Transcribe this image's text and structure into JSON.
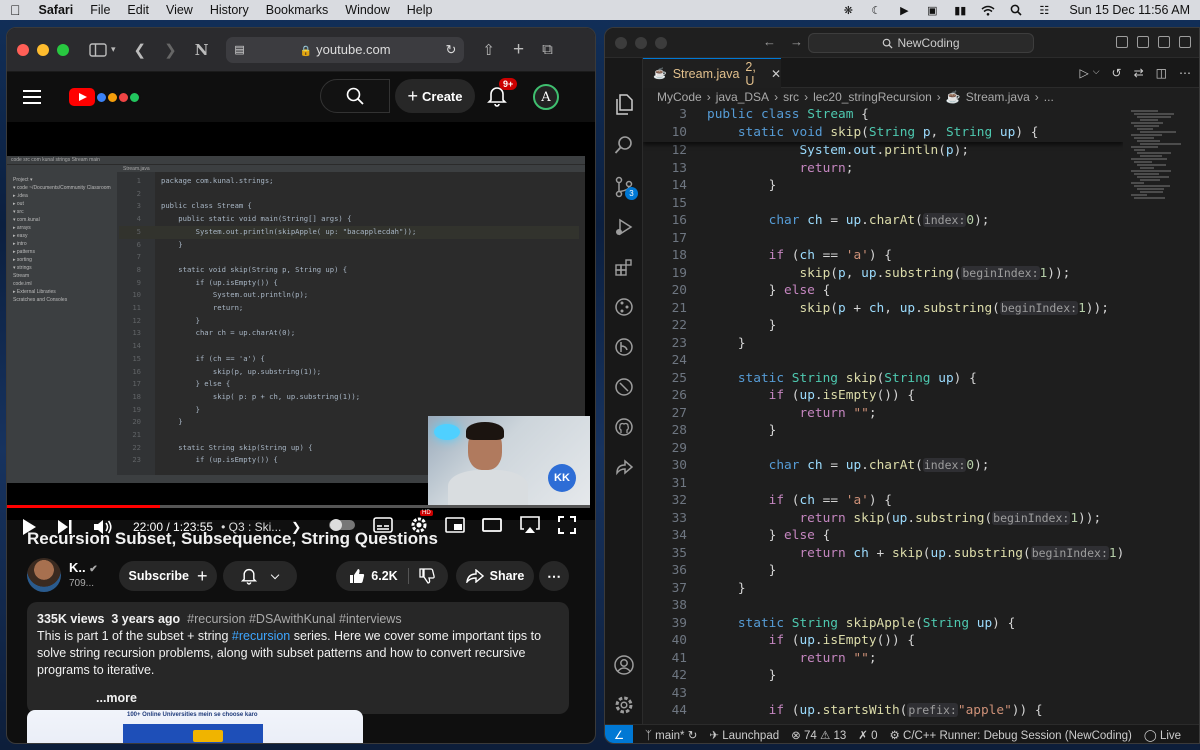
{
  "menubar": {
    "app": "Safari",
    "items": [
      "File",
      "Edit",
      "View",
      "History",
      "Bookmarks",
      "Window",
      "Help"
    ],
    "clock": "Sun 15 Dec  11:56 AM"
  },
  "safari": {
    "url": "youtube.com",
    "youtube": {
      "create_label": "Create",
      "notification_count": "9+",
      "avatar_letter": "A",
      "video": {
        "time": "22:00 / 1:23:55",
        "chapter": "• Q3 : Ski...",
        "progress_fraction": 0.262,
        "hd_badge": "HD",
        "ide_tab": "Stream.java",
        "ide_breadcrumb": "code  src  com  kunal  strings  Stream  main",
        "ide_tree": [
          "Project ▾",
          "▾ code ~/Documents/Community Classroom",
          "  ▸ .idea",
          "  ▸ out",
          "  ▾ src",
          "    ▾ com.kunal",
          "      ▸ arrays",
          "      ▸ easy",
          "      ▸ intro",
          "      ▸ patterns",
          "      ▸ sorting",
          "      ▾ strings",
          "          Stream",
          "  code.iml",
          "▸ External Libraries",
          "  Scratches and Consoles"
        ],
        "ide_lines": [
          {
            "n": "1",
            "code": "package com.kunal.strings;"
          },
          {
            "n": "2",
            "code": ""
          },
          {
            "n": "3",
            "code": "public class Stream {"
          },
          {
            "n": "4",
            "code": "    public static void main(String[] args) {"
          },
          {
            "n": "5",
            "code": "        System.out.println(skipApple( up: \"bacapplecdah\"));"
          },
          {
            "n": "6",
            "code": "    }"
          },
          {
            "n": "7",
            "code": ""
          },
          {
            "n": "8",
            "code": "    static void skip(String p, String up) {"
          },
          {
            "n": "9",
            "code": "        if (up.isEmpty()) {"
          },
          {
            "n": "10",
            "code": "            System.out.println(p);"
          },
          {
            "n": "11",
            "code": "            return;"
          },
          {
            "n": "12",
            "code": "        }"
          },
          {
            "n": "13",
            "code": "        char ch = up.charAt(0);"
          },
          {
            "n": "14",
            "code": ""
          },
          {
            "n": "15",
            "code": "        if (ch == 'a') {"
          },
          {
            "n": "16",
            "code": "            skip(p, up.substring(1));"
          },
          {
            "n": "17",
            "code": "        } else {"
          },
          {
            "n": "18",
            "code": "            skip( p: p + ch, up.substring(1));"
          },
          {
            "n": "19",
            "code": "        }"
          },
          {
            "n": "20",
            "code": "    }"
          },
          {
            "n": "21",
            "code": ""
          },
          {
            "n": "22",
            "code": "    static String skip(String up) {"
          },
          {
            "n": "23",
            "code": "        if (up.isEmpty()) {"
          }
        ],
        "webcam_logo": "KK"
      },
      "title": "Recursion Subset, Subsequence, String Questions",
      "channel_name": "K..",
      "channel_subs": "709...",
      "subscribe_label": "Subscribe",
      "likes": "6.2K",
      "share_label": "Share",
      "description": {
        "views": "335K views",
        "age": "3 years ago",
        "tags": "#recursion #DSAwithKunal #interviews",
        "text_before": "This is part 1 of the subset + string ",
        "tag_inline": "#recursion",
        "text_after": " series. Here we cover some important tips to solve string recursion problems, along with subset patterns and how to convert recursive programs to iterative.",
        "more": "...more"
      },
      "ad_text": "100+ Online Universities mein se choose karo"
    }
  },
  "vscode": {
    "search": "NewCoding",
    "tab": {
      "name": "Stream.java",
      "status": "2, U"
    },
    "breadcrumb": [
      "MyCode",
      "java_DSA",
      "src",
      "lec20_stringRecursion",
      "Stream.java",
      "..."
    ],
    "status": {
      "branch": "main*",
      "launchpad": "Launchpad",
      "errors": "74",
      "warnings": "13",
      "ports": "0",
      "runner": "C/C++ Runner: Debug Session (NewCoding)",
      "live": "Live"
    },
    "scm_badge": "3"
  }
}
